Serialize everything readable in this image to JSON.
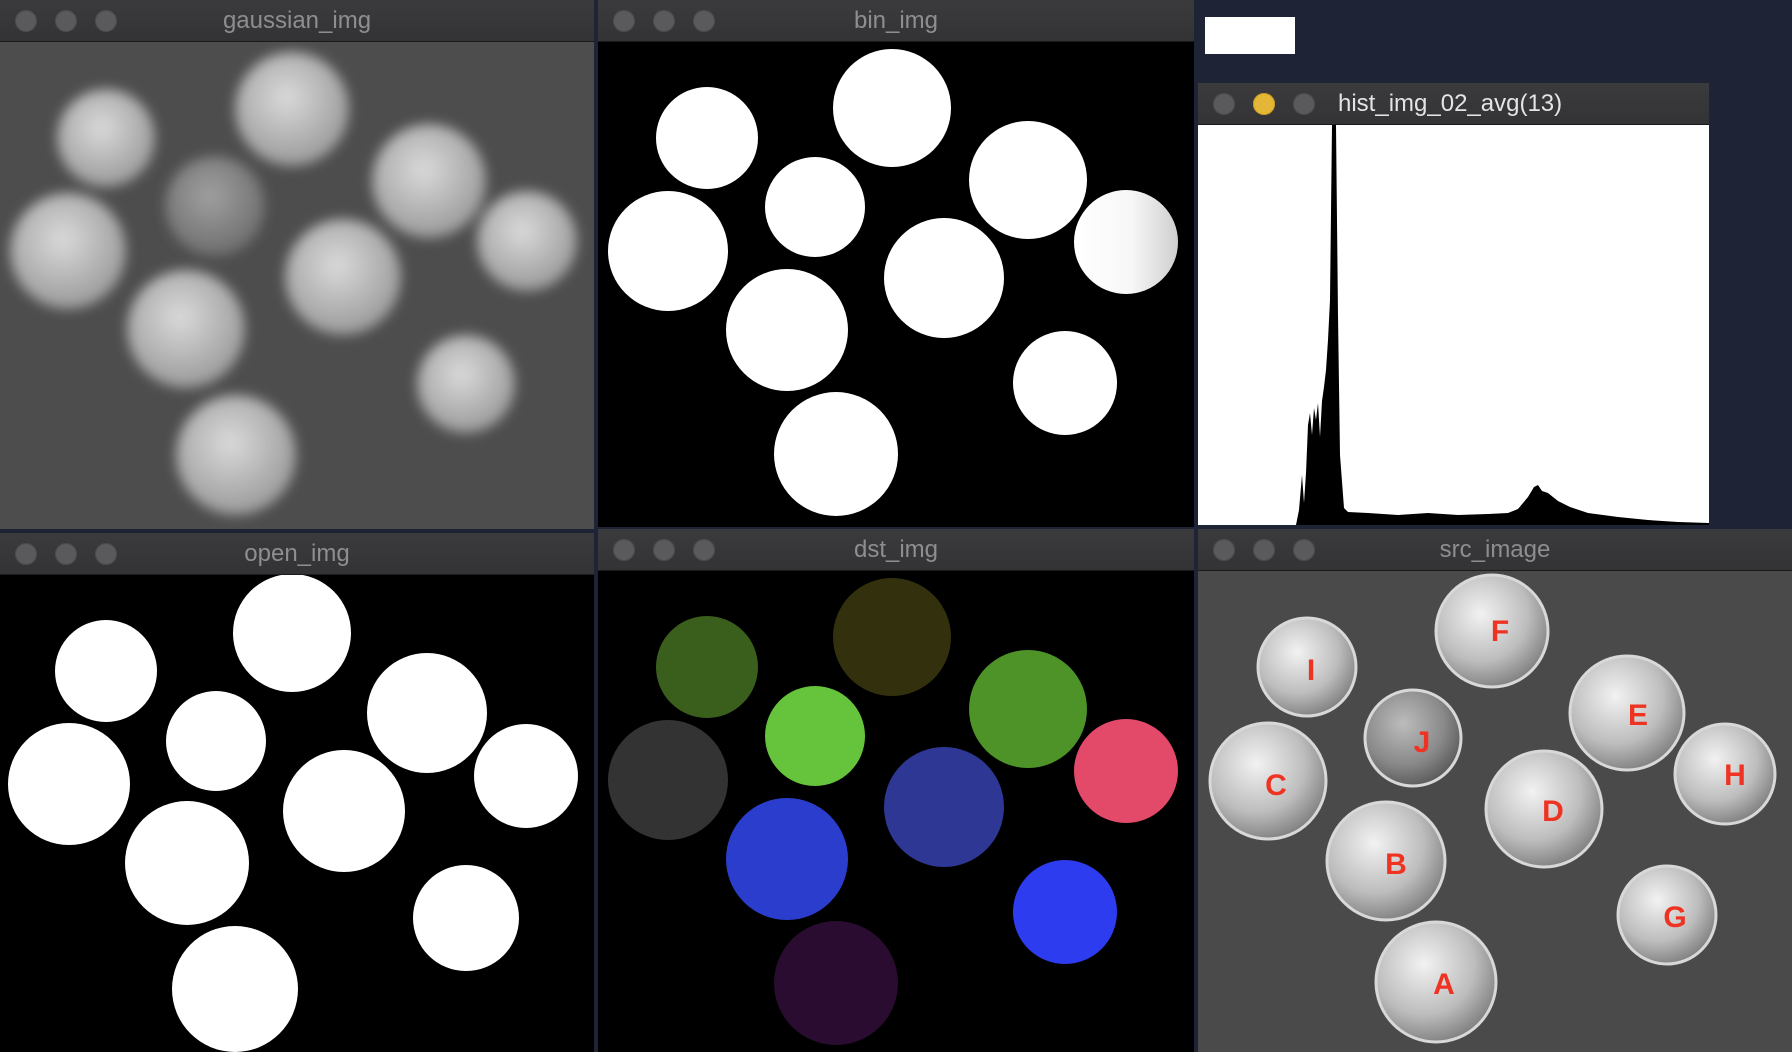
{
  "windows": {
    "gaussian": {
      "title": "gaussian_img"
    },
    "bin": {
      "title": "bin_img"
    },
    "hist": {
      "title": "hist_img_02_avg(13)"
    },
    "open": {
      "title": "open_img"
    },
    "dst": {
      "title": "dst_img"
    },
    "src": {
      "title": "src_image"
    }
  },
  "coin_labels": [
    "F",
    "I",
    "J",
    "E",
    "C",
    "H",
    "D",
    "B",
    "G",
    "A"
  ],
  "colors": {
    "desktop": "#1f2336",
    "titlebar": "#3b3b3d",
    "minimize_active": "#e3b637",
    "label_red": "#ee3322",
    "dst_regions": [
      "#3a5e1c",
      "#33300e",
      "#4e9328",
      "#333333",
      "#66c43c",
      "#e34a6a",
      "#2e3894",
      "#2b3dcc",
      "#2e3cf0",
      "#2a0c30"
    ]
  }
}
